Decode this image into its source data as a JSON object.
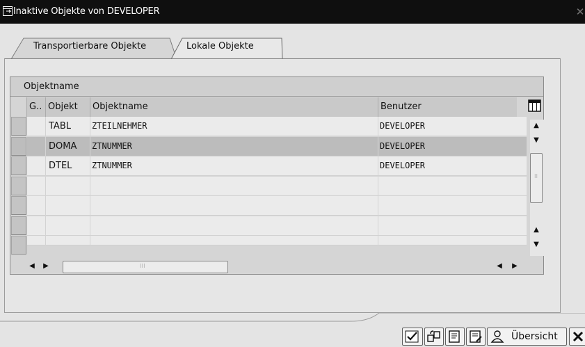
{
  "window": {
    "title": "Inaktive Objekte von DEVELOPER",
    "close_glyph": "✕"
  },
  "tabs": [
    {
      "label": "Transportierbare Objekte",
      "active": false
    },
    {
      "label": "Lokale Objekte",
      "active": true
    }
  ],
  "grid": {
    "title": "Objektname",
    "columns": [
      "G..",
      "Objekt",
      "Objektname",
      "Benutzer"
    ],
    "rows": [
      {
        "g": "",
        "objekt": "TABL",
        "objektname": "ZTEILNEHMER",
        "benutzer": "DEVELOPER",
        "selected": false
      },
      {
        "g": "",
        "objekt": "DOMA",
        "objektname": "ZTNUMMER",
        "benutzer": "DEVELOPER",
        "selected": true
      },
      {
        "g": "",
        "objekt": "DTEL",
        "objektname": "ZTNUMMER",
        "benutzer": "DEVELOPER",
        "selected": false
      }
    ],
    "empty_rows": 4
  },
  "footer": {
    "overview_label": "Übersicht"
  },
  "icons": [
    "window-icon",
    "close-icon",
    "layout-settings-icon",
    "scroll-up-icon",
    "scroll-down-icon",
    "check-icon",
    "activate-icon",
    "display-icon",
    "change-icon",
    "overview-person-icon",
    "cancel-icon"
  ]
}
